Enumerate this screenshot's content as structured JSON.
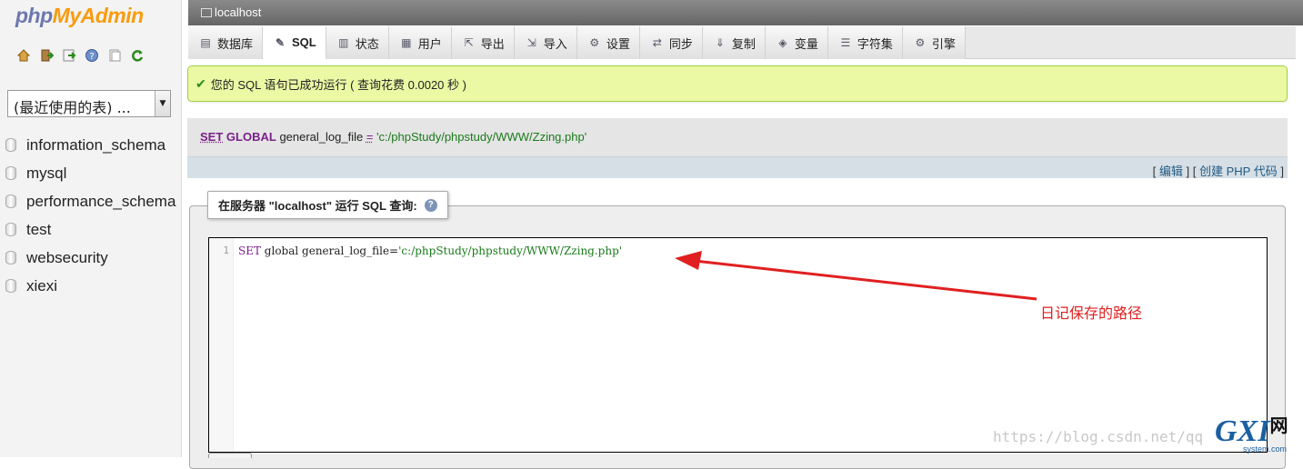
{
  "logo": {
    "part1": "php",
    "part2": "MyAdmin"
  },
  "quick_icons": [
    "home-icon",
    "exit-icon",
    "sql-query-icon",
    "help-icon",
    "docs-icon",
    "reload-icon"
  ],
  "recent_tables": {
    "value": "(最近使用的表) ..."
  },
  "databases": [
    "information_schema",
    "mysql",
    "performance_schema",
    "test",
    "websecurity",
    "xiexi"
  ],
  "topbar": {
    "server": "localhost"
  },
  "tabs": [
    {
      "label": "数据库",
      "icon": "database-icon"
    },
    {
      "label": "SQL",
      "icon": "sql-icon",
      "active": true
    },
    {
      "label": "状态",
      "icon": "status-icon"
    },
    {
      "label": "用户",
      "icon": "users-icon"
    },
    {
      "label": "导出",
      "icon": "export-icon"
    },
    {
      "label": "导入",
      "icon": "import-icon"
    },
    {
      "label": "设置",
      "icon": "settings-icon"
    },
    {
      "label": "同步",
      "icon": "sync-icon"
    },
    {
      "label": "复制",
      "icon": "replication-icon"
    },
    {
      "label": "变量",
      "icon": "variables-icon"
    },
    {
      "label": "字符集",
      "icon": "charset-icon"
    },
    {
      "label": "引擎",
      "icon": "engines-icon"
    }
  ],
  "success_message": "您的 SQL 语句已成功运行 ( 查询花费 0.0020 秒 )",
  "executed_sql": {
    "kw1": "SET",
    "kw2": "GLOBAL",
    "var": "general_log_file",
    "op": "=",
    "value": "'c:/phpStudy/phpstudy/WWW/Zzing.php'"
  },
  "links": {
    "open1": "[",
    "edit": "编辑",
    "sep": "] [",
    "create_php": "创建 PHP 代码",
    "close": "]"
  },
  "query_box": {
    "legend": "在服务器 \"localhost\" 运行 SQL 查询:",
    "help": "?"
  },
  "editor": {
    "line_number": "1",
    "kw": "SET",
    "code_mid": " global general_log_file=",
    "code_str": "'c:/phpStudy/phpstudy/WWW/Zzing.php'"
  },
  "annotation": {
    "text": "日记保存的路径",
    "color": "#e02020"
  },
  "watermark": {
    "url": "https://blog.csdn.net/qq",
    "brand": "GXI",
    "brand_cn": "网",
    "brand_sub": "system.com"
  },
  "colors": {
    "keyword": "#7a1f8a",
    "string": "#1a7a1a",
    "success_bg": "#ebf8a4",
    "link": "#235a81"
  }
}
